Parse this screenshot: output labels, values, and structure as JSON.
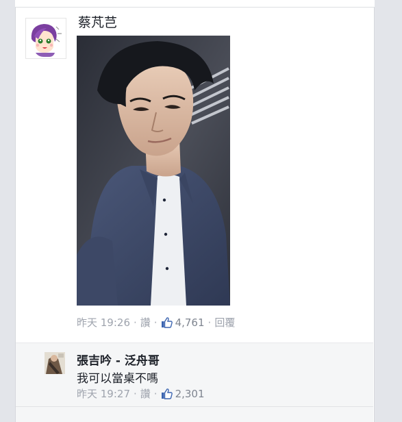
{
  "post": {
    "author": "蔡芃芑",
    "time": "昨天 19:26",
    "like_label": "讚",
    "like_count": "4,761",
    "reply_label": "回覆"
  },
  "reply": {
    "author": "張吉吟 - 泛舟哥",
    "text": "我可以當桌不嗎",
    "time": "昨天 19:27",
    "like_label": "讚",
    "like_count": "2,301"
  },
  "icons": {
    "like": "thumbs-up-icon"
  },
  "colors": {
    "meta_text": "#9ea3ad",
    "author_text": "#1d2129",
    "reply_background": "#f5f6f7",
    "page_rail": "#e3e5ea"
  }
}
